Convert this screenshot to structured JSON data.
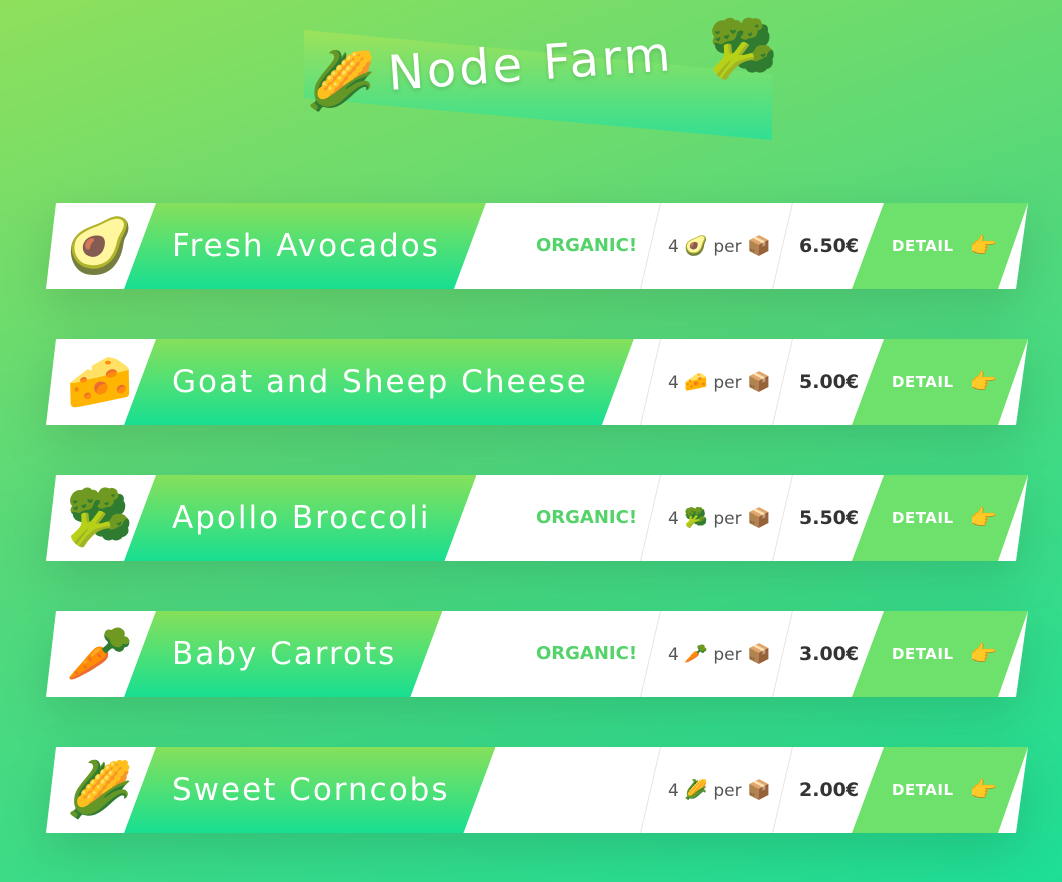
{
  "header": {
    "title": "Node Farm",
    "emoji_left": "🌽",
    "emoji_right": "🥦"
  },
  "products": [
    {
      "emoji": "🥑",
      "name": "Fresh Avocados",
      "organic": "ORGANIC!",
      "qty_count": "4",
      "qty_emoji": "🥑",
      "qty_per": "per",
      "box_emoji": "📦",
      "price": "6.50€",
      "detail_label": "DETAIL",
      "detail_icon": "👉"
    },
    {
      "emoji": "🧀",
      "name": "Goat and Sheep Cheese",
      "organic": "",
      "qty_count": "4",
      "qty_emoji": "🧀",
      "qty_per": "per",
      "box_emoji": "📦",
      "price": "5.00€",
      "detail_label": "DETAIL",
      "detail_icon": "👉"
    },
    {
      "emoji": "🥦",
      "name": "Apollo Broccoli",
      "organic": "ORGANIC!",
      "qty_count": "4",
      "qty_emoji": "🥦",
      "qty_per": "per",
      "box_emoji": "📦",
      "price": "5.50€",
      "detail_label": "DETAIL",
      "detail_icon": "👉"
    },
    {
      "emoji": "🥕",
      "name": "Baby Carrots",
      "organic": "ORGANIC!",
      "qty_count": "4",
      "qty_emoji": "🥕",
      "qty_per": "per",
      "box_emoji": "📦",
      "price": "3.00€",
      "detail_label": "DETAIL",
      "detail_icon": "👉"
    },
    {
      "emoji": "🌽",
      "name": "Sweet Corncobs",
      "organic": "",
      "qty_count": "4",
      "qty_emoji": "🌽",
      "qty_per": "per",
      "box_emoji": "📦",
      "price": "2.00€",
      "detail_label": "DETAIL",
      "detail_icon": "👉"
    }
  ],
  "colors": {
    "accent_green": "#55d36b",
    "detail_bg": "#6ee06c",
    "price_text": "#333333"
  }
}
